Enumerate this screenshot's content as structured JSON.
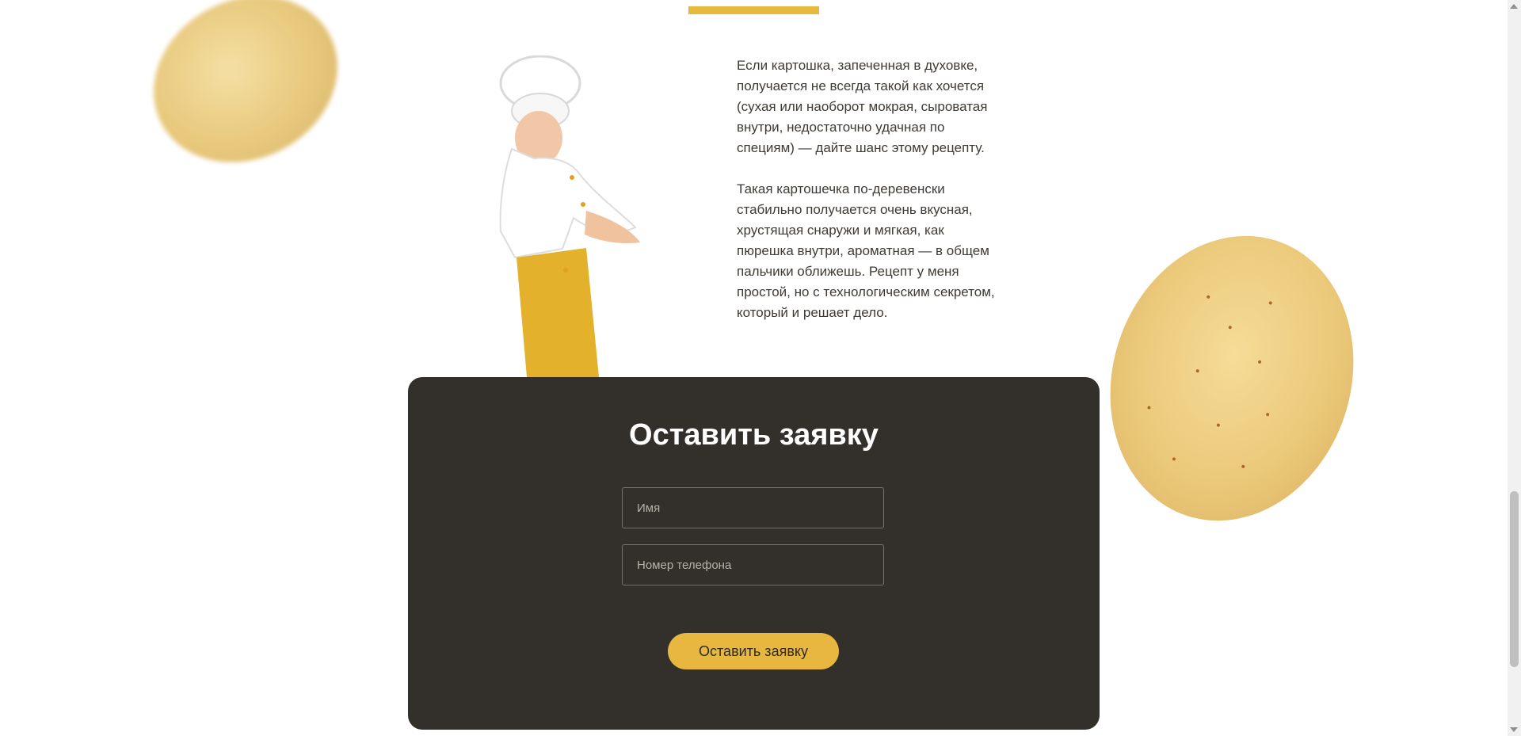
{
  "story": {
    "paragraphs": [
      "Если картошка, запеченная в духовке, получается не всегда такой как хочется (сухая или наоборот мокрая, сыроватая внутри, недостаточно удачная по специям) — дайте шанс этому рецепту.",
      "Такая картошечка по-деревенски стабильно получается очень вкусная, хрустящая снаружи и мягкая, как пюрешка внутри, ароматная — в общем пальчики оближешь. Рецепт у меня простой, но с технологическим секретом, который и решает дело."
    ]
  },
  "form": {
    "title": "Оставить заявку",
    "name_placeholder": "Имя",
    "phone_placeholder": "Номер телефона",
    "submit_label": "Оставить заявку"
  },
  "colors": {
    "accent": "#e7b93d",
    "panel": "#332f2b",
    "text": "#3f3a34"
  },
  "icons": {
    "scroll_up": "scroll-up-icon",
    "scroll_down": "scroll-down-icon"
  }
}
